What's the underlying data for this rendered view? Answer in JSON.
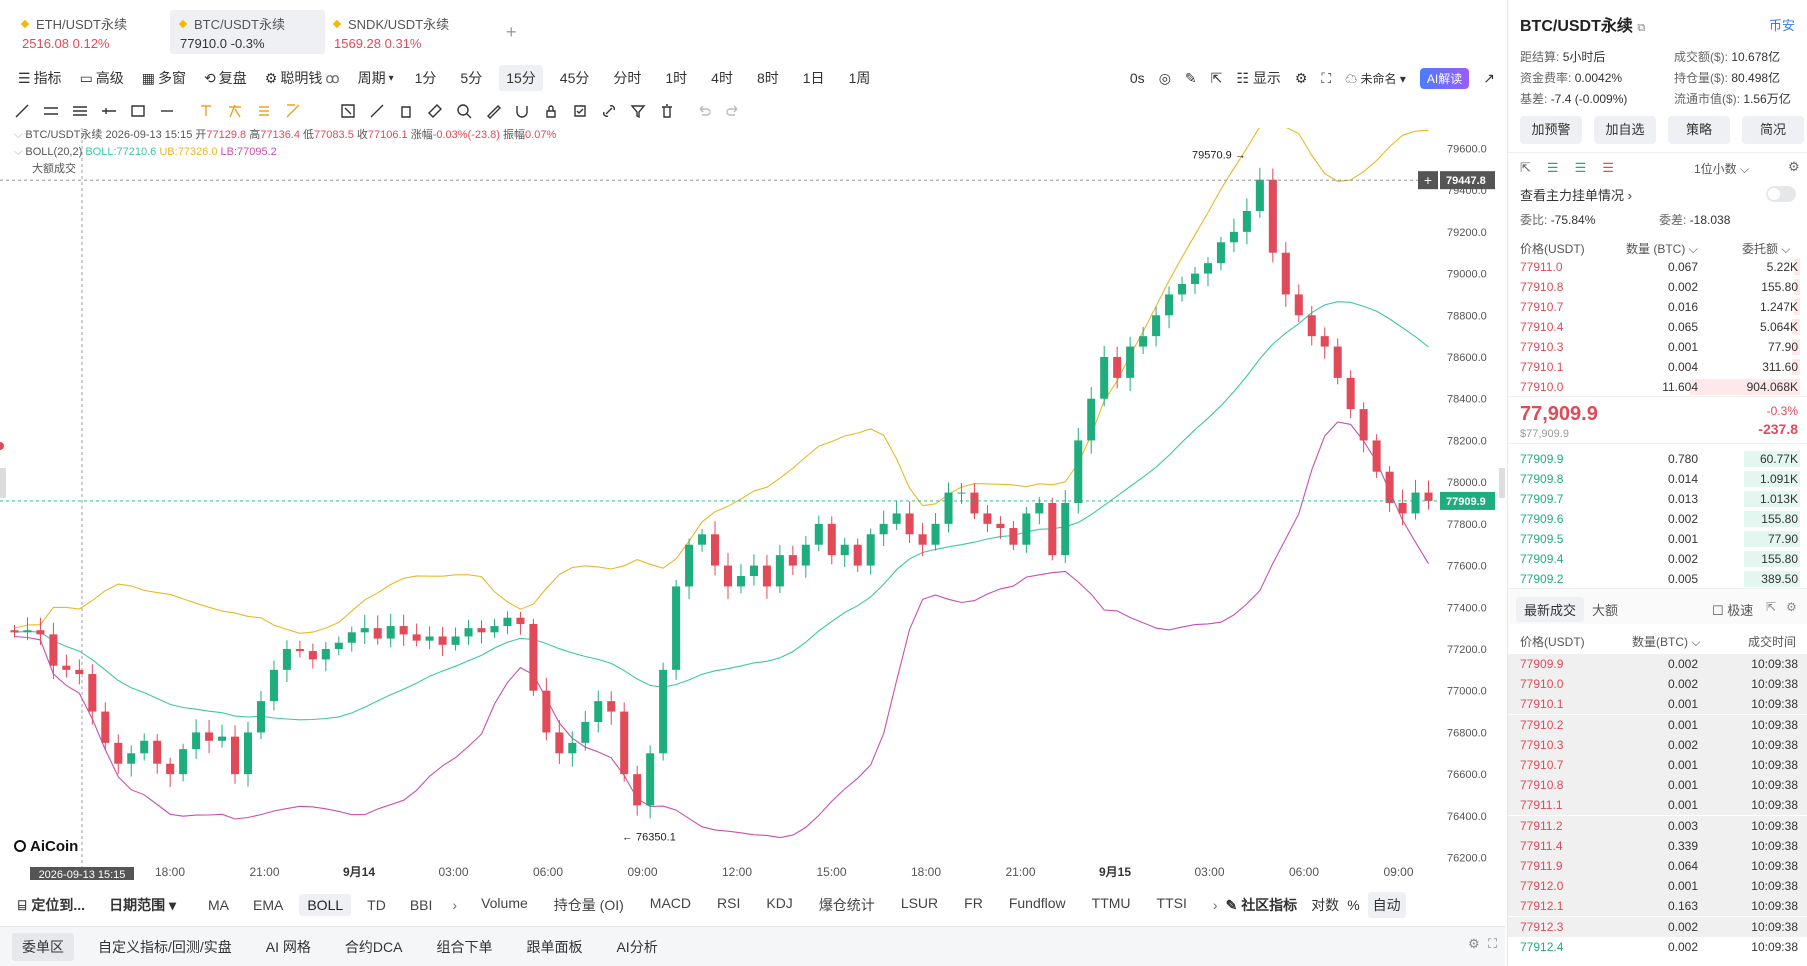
{
  "tabs": [
    {
      "name": "ETH/USDT永续",
      "price": "2516.08",
      "change": "0.12%",
      "active": false
    },
    {
      "name": "BTC/USDT永续",
      "price": "77910.0",
      "change": "-0.3%",
      "active": true
    },
    {
      "name": "SNDK/USDT永续",
      "price": "1569.28",
      "change": "0.31%",
      "active": false
    }
  ],
  "add_tab": "+",
  "toolbar": {
    "items": [
      "指标",
      "高级",
      "多窗",
      "复盘",
      "聪明钱"
    ],
    "period_label": "周期",
    "periods": [
      "1分",
      "5分",
      "15分",
      "45分",
      "分时",
      "1时",
      "4时",
      "8时",
      "1日",
      "1周"
    ],
    "selected_period": "15分",
    "countdown": "0s",
    "display": "显示",
    "unnamed": "未命名",
    "ai": "AI解读"
  },
  "legend": {
    "symbol": "BTC/USDT永续",
    "datetime": "2026-09-13 15:15",
    "open_label": "开",
    "open": "77129.8",
    "high_label": "高",
    "high": "77136.4",
    "low_label": "低",
    "low": "77083.5",
    "close_label": "收",
    "close": "77106.1",
    "change_label": "涨幅",
    "change": "-0.03%(-23.8)",
    "amp_label": "振幅",
    "amp": "0.07%",
    "boll_name": "BOLL(20,2)",
    "boll": "BOLL:77210.6",
    "ub": "UB:77326.0",
    "lb": "LB:77095.2",
    "big_trade": "大额成交"
  },
  "chart_data": {
    "type": "candlestick",
    "ylim": [
      76150,
      79650
    ],
    "y_ticks": [
      "79600.0",
      "79400.0",
      "79200.0",
      "79000.0",
      "78800.0",
      "78600.0",
      "78400.0",
      "78200.0",
      "78000.0",
      "77800.0",
      "77600.0",
      "77400.0",
      "77200.0",
      "77000.0",
      "76800.0",
      "76600.0",
      "76400.0",
      "76200.0"
    ],
    "x_ticks": [
      "18:00",
      "21:00",
      "9月14",
      "03:00",
      "06:00",
      "09:00",
      "12:00",
      "15:00",
      "18:00",
      "21:00",
      "9月15",
      "03:00",
      "06:00",
      "09:00"
    ],
    "cursor_time": "2026-09-13 15:15",
    "crosshair_price": "79447.8",
    "last_price": "77909.9",
    "high_marker": "79570.9 →",
    "low_marker": "← 76350.1",
    "watermark": "AiCoin",
    "colors": {
      "up": "#1fad7e",
      "down": "#e04a59",
      "boll": "#3cc8a5",
      "ub": "#e8b82a",
      "lb": "#c94fb0"
    },
    "close_series": [
      77280,
      77290,
      77270,
      77120,
      77100,
      77080,
      76900,
      76750,
      76650,
      76700,
      76760,
      76650,
      76600,
      76720,
      76800,
      76760,
      76780,
      76600,
      76800,
      76950,
      77100,
      77200,
      77190,
      77150,
      77200,
      77230,
      77280,
      77300,
      77250,
      77310,
      77270,
      77240,
      77260,
      77220,
      77260,
      77300,
      77280,
      77310,
      77350,
      77320,
      77000,
      76800,
      76700,
      76750,
      76850,
      76950,
      76900,
      76600,
      76450,
      76700,
      77100,
      77500,
      77700,
      77750,
      77600,
      77500,
      77550,
      77600,
      77500,
      77650,
      77600,
      77700,
      77800,
      77650,
      77700,
      77600,
      77750,
      77800,
      77850,
      77750,
      77700,
      77800,
      77950,
      77950,
      77850,
      77800,
      77780,
      77700,
      77850,
      77900,
      77650,
      77900,
      78200,
      78400,
      78600,
      78500,
      78650,
      78700,
      78800,
      78900,
      78950,
      79000,
      79050,
      79150,
      79200,
      79300,
      79450,
      79100,
      78900,
      78800,
      78700,
      78650,
      78500,
      78350,
      78200,
      78050,
      77900,
      77850,
      77950,
      77910
    ]
  },
  "bottom_bar": {
    "locate": "定位到...",
    "date_range": "日期范围",
    "indicators": [
      "MA",
      "EMA",
      "BOLL",
      "TD",
      "BBI"
    ],
    "selected": "BOLL",
    "sub_indicators": [
      "Volume",
      "持仓量 (OI)",
      "MACD",
      "RSI",
      "KDJ",
      "爆仓统计",
      "LSUR",
      "FR",
      "Fundflow",
      "TTMU",
      "TTSI"
    ],
    "community": "社区指标",
    "log": "对数",
    "percent": "%",
    "auto": "自动"
  },
  "footer": {
    "tabs": [
      "委单区",
      "自定义指标/回测/实盘",
      "AI 网格",
      "合约DCA",
      "组合下单",
      "跟单面板",
      "AI分析"
    ],
    "selected": "委单区"
  },
  "panel": {
    "title": "BTC/USDT永续",
    "exchange": "币安",
    "settle_label": "距结算:",
    "settle": "5小时后",
    "turnover_label": "成交额($):",
    "turnover": "10.678亿",
    "funding_label": "资金费率:",
    "funding": "0.0042%",
    "oi_label": "持仓量($):",
    "oi": "80.498亿",
    "basis_label": "基差:",
    "basis": "-7.4 (-0.009%)",
    "mcap_label": "流通市值($):",
    "mcap": "1.56万亿",
    "buttons": [
      "加预警",
      "加自选",
      "策略",
      "简况"
    ],
    "decimal": "1位小数",
    "main_orders": "查看主力挂单情况",
    "ratio_label": "委比:",
    "ratio": "-75.84%",
    "diff_label": "委差:",
    "diff": "-18.038",
    "ob_headers": [
      "价格(USDT)",
      "数量 (BTC)",
      "委托额"
    ],
    "asks": [
      {
        "p": "77911.0",
        "q": "0.067",
        "a": "5.22K",
        "w": 0.03
      },
      {
        "p": "77910.8",
        "q": "0.002",
        "a": "155.80",
        "w": 0.03
      },
      {
        "p": "77910.7",
        "q": "0.016",
        "a": "1.247K",
        "w": 0.03
      },
      {
        "p": "77910.4",
        "q": "0.065",
        "a": "5.064K",
        "w": 0.04
      },
      {
        "p": "77910.3",
        "q": "0.001",
        "a": "77.90",
        "w": 0.04
      },
      {
        "p": "77910.1",
        "q": "0.004",
        "a": "311.60",
        "w": 0.04
      },
      {
        "p": "77910.0",
        "q": "11.604",
        "a": "904.068K",
        "w": 0.55
      }
    ],
    "last": "77,909.9",
    "last_usd": "$77,909.9",
    "last_pct": "-0.3%",
    "last_chg": "-237.8",
    "bids": [
      {
        "p": "77909.9",
        "q": "0.780",
        "a": "60.77K",
        "w": 0.28
      },
      {
        "p": "77909.8",
        "q": "0.014",
        "a": "1.091K",
        "w": 0.28
      },
      {
        "p": "77909.7",
        "q": "0.013",
        "a": "1.013K",
        "w": 0.28
      },
      {
        "p": "77909.6",
        "q": "0.002",
        "a": "155.80",
        "w": 0.28
      },
      {
        "p": "77909.5",
        "q": "0.001",
        "a": "77.90",
        "w": 0.28
      },
      {
        "p": "77909.4",
        "q": "0.002",
        "a": "155.80",
        "w": 0.28
      },
      {
        "p": "77909.2",
        "q": "0.005",
        "a": "389.50",
        "w": 0.28
      }
    ],
    "trade_tabs": [
      "最新成交",
      "大额"
    ],
    "speed": "极速",
    "trade_headers": [
      "价格(USDT)",
      "数量(BTC)",
      "成交时间"
    ],
    "trades": [
      {
        "p": "77909.9",
        "q": "0.002",
        "t": "10:09:38",
        "s": "down"
      },
      {
        "p": "77910.0",
        "q": "0.002",
        "t": "10:09:38",
        "s": "down"
      },
      {
        "p": "77910.1",
        "q": "0.001",
        "t": "10:09:38",
        "s": "down"
      },
      {
        "p": "77910.2",
        "q": "0.001",
        "t": "10:09:38",
        "s": "down"
      },
      {
        "p": "77910.3",
        "q": "0.002",
        "t": "10:09:38",
        "s": "down"
      },
      {
        "p": "77910.7",
        "q": "0.001",
        "t": "10:09:38",
        "s": "down"
      },
      {
        "p": "77910.8",
        "q": "0.001",
        "t": "10:09:38",
        "s": "down"
      },
      {
        "p": "77911.1",
        "q": "0.001",
        "t": "10:09:38",
        "s": "down"
      },
      {
        "p": "77911.2",
        "q": "0.003",
        "t": "10:09:38",
        "s": "down"
      },
      {
        "p": "77911.4",
        "q": "0.339",
        "t": "10:09:38",
        "s": "down"
      },
      {
        "p": "77911.9",
        "q": "0.064",
        "t": "10:09:38",
        "s": "down"
      },
      {
        "p": "77912.0",
        "q": "0.001",
        "t": "10:09:38",
        "s": "down"
      },
      {
        "p": "77912.1",
        "q": "0.163",
        "t": "10:09:38",
        "s": "down"
      },
      {
        "p": "77912.3",
        "q": "0.002",
        "t": "10:09:38",
        "s": "down"
      },
      {
        "p": "77912.4",
        "q": "0.002",
        "t": "10:09:38",
        "s": "up"
      }
    ]
  }
}
